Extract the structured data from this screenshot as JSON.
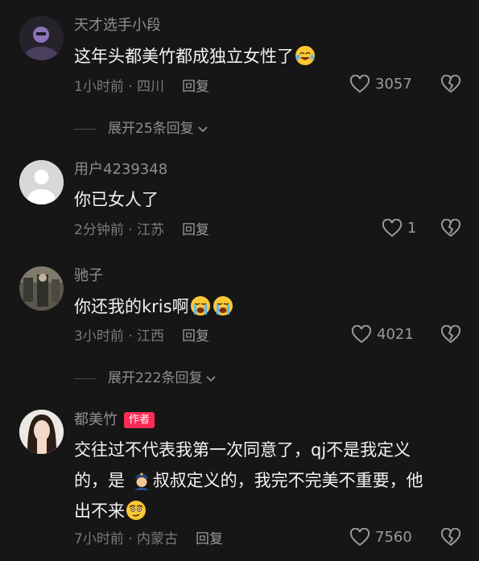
{
  "comments": [
    {
      "username": "天才选手小段",
      "text": "这年头都美竹都成独立女性了",
      "time_location": "1小时前 · 四川",
      "reply": "回复",
      "likes": "3057",
      "emoji": [
        "laughing-tears-emoji"
      ]
    },
    {
      "username": "用户4239348",
      "text": "你已女人了",
      "time_location": "2分钟前 · 江苏",
      "reply": "回复",
      "likes": "1"
    },
    {
      "username": "驰子",
      "text": "你还我的kris啊",
      "time_location": "3小时前 · 江西",
      "reply": "回复",
      "likes": "4021",
      "emoji": [
        "crying-emoji",
        "crying-emoji"
      ]
    },
    {
      "username": "都美竹",
      "author_badge": "作者",
      "text_line1": "交往过不代表我第一次同意了，qj不是我定义",
      "text_line2a": "的，是",
      "text_line2b": "叔叔定义的，我完不完美不重要，他",
      "text_line3": "出不来",
      "time_location": "7小时前 · 内蒙古",
      "reply": "回复",
      "likes": "7560",
      "emoji": [
        "police-officer-emoji",
        "smirk-emoji"
      ]
    }
  ],
  "expand_replies": [
    {
      "label": "展开25条回复"
    },
    {
      "label": "展开222条回复"
    }
  ],
  "colors": {
    "background": "#161616",
    "badge": "#fe2c55",
    "meta": "#7a7a7a"
  }
}
